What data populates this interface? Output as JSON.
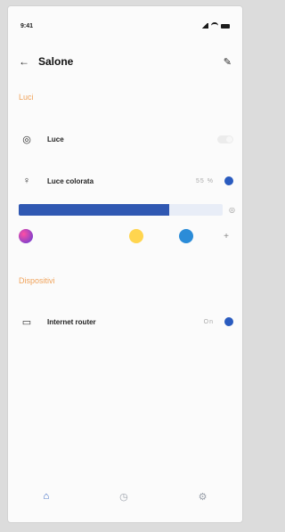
{
  "status": {
    "time": "9:41"
  },
  "header": {
    "title": "Salone"
  },
  "sections": [
    {
      "title": "Luci"
    },
    {
      "title": "Dispositivi"
    }
  ],
  "devices": [
    {
      "name": "Luce"
    },
    {
      "name": "Luce colorata",
      "value": "55 %"
    },
    {
      "name": "Internet router",
      "value": "On"
    }
  ],
  "luce_colorata": {
    "brightness_fraction": 0.74
  },
  "colors": [
    {
      "name": "purple-magenta"
    },
    {
      "name": "yellow"
    },
    {
      "name": "blue"
    }
  ],
  "nav": {
    "active": "home"
  },
  "theme": {
    "accent": "#2a5bbf",
    "section_color": "#f0a35b"
  }
}
